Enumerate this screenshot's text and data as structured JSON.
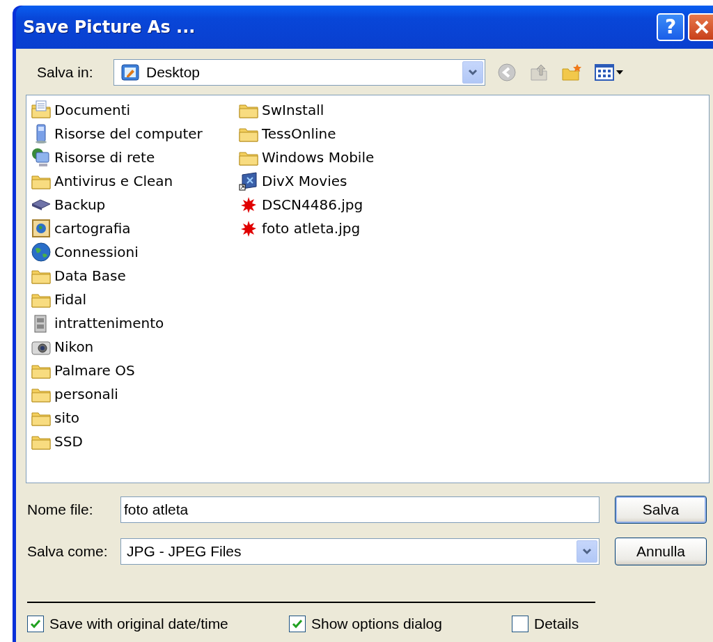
{
  "window": {
    "title": "Save Picture As ...",
    "help": "?"
  },
  "location": {
    "label": "Salva in:",
    "value": "Desktop"
  },
  "files": [
    {
      "name": "Documenti",
      "kind": "documents"
    },
    {
      "name": "Risorse del computer",
      "kind": "computer"
    },
    {
      "name": "Risorse di rete",
      "kind": "network"
    },
    {
      "name": "Antivirus e Clean",
      "kind": "folder"
    },
    {
      "name": "Backup",
      "kind": "drive"
    },
    {
      "name": "cartografia",
      "kind": "map"
    },
    {
      "name": "Connessioni",
      "kind": "globe"
    },
    {
      "name": "Data Base",
      "kind": "folder"
    },
    {
      "name": "Fidal",
      "kind": "folder"
    },
    {
      "name": "intrattenimento",
      "kind": "archive"
    },
    {
      "name": "Nikon",
      "kind": "camera"
    },
    {
      "name": "Palmare OS",
      "kind": "folder"
    },
    {
      "name": "personali",
      "kind": "folder"
    },
    {
      "name": "sito",
      "kind": "folder"
    },
    {
      "name": "SSD",
      "kind": "folder"
    },
    {
      "name": "SwInstall",
      "kind": "folder"
    },
    {
      "name": "TessOnline",
      "kind": "folder"
    },
    {
      "name": "Windows Mobile",
      "kind": "folder"
    },
    {
      "name": "DivX Movies",
      "kind": "video"
    },
    {
      "name": "DSCN4486.jpg",
      "kind": "image"
    },
    {
      "name": "foto atleta.jpg",
      "kind": "image"
    }
  ],
  "filename": {
    "label": "Nome file:",
    "value": "foto atleta"
  },
  "filetype": {
    "label": "Salva come:",
    "value": "JPG - JPEG Files"
  },
  "buttons": [
    {
      "label": "Salva",
      "default": true
    },
    {
      "label": "Annulla",
      "default": false
    }
  ],
  "options": [
    {
      "label": "Save with original date/time",
      "checked": true
    },
    {
      "label": "Show options dialog",
      "checked": true
    },
    {
      "label": "Details",
      "checked": false
    }
  ]
}
